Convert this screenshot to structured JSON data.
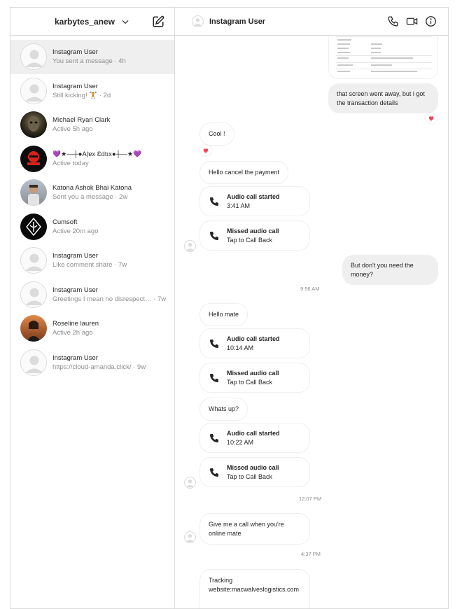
{
  "sidebar": {
    "account_name": "karbytes_anew",
    "threads": [
      {
        "name": "Instagram User",
        "sub": "You sent a message · 4h",
        "avatar": "default-avatar"
      },
      {
        "name": "Instagram User",
        "sub": "Still kicking! 🏋 · 2d",
        "avatar": "default-avatar"
      },
      {
        "name": "Michael Ryan Clark",
        "sub": "Active 5h ago",
        "avatar": "photo-avatar"
      },
      {
        "name": "💜★—┼●A|ɐx Ɛdtıx●┼—★💜",
        "sub": "Active today",
        "avatar": "photo-avatar"
      },
      {
        "name": "Katona Ashok Bhai Katona",
        "sub": "Sent you a message · 2w",
        "avatar": "photo-avatar"
      },
      {
        "name": "Cumsoft",
        "sub": "Active 20m ago",
        "avatar": "logo-avatar"
      },
      {
        "name": "Instagram User",
        "sub": "Like comment share · 7w",
        "avatar": "default-avatar"
      },
      {
        "name": "Instagram User",
        "sub": "Greetings I mean no disrespect… · 7w",
        "avatar": "default-avatar"
      },
      {
        "name": "Roseline lauren",
        "sub": "Active 2h ago",
        "avatar": "photo-avatar"
      },
      {
        "name": "Instagram User",
        "sub": "https://cloud-amanda.click/ · 9w",
        "avatar": "default-avatar"
      }
    ]
  },
  "chat": {
    "title": "Instagram User",
    "messages": {
      "m1": "that screen went away, but i got the transaction details",
      "m2": "Cool !",
      "m3": "Hello cancel the payment",
      "call1": {
        "title": "Audio call started",
        "sub": "3:41 AM"
      },
      "call2": {
        "title": "Missed audio call",
        "sub": "Tap to Call Back"
      },
      "m4": "But don't you need the money?",
      "ts1": "9:56 AM",
      "m5": "Hello mate",
      "call3": {
        "title": "Audio call started",
        "sub": "10:14 AM"
      },
      "call4": {
        "title": "Missed audio call",
        "sub": "Tap to Call Back"
      },
      "m6": "Whats up?",
      "call5": {
        "title": "Audio call started",
        "sub": "10:22 AM"
      },
      "call6": {
        "title": "Missed audio call",
        "sub": "Tap to Call Back"
      },
      "ts2": "12:07 PM",
      "m7": "Give me a call when you're online mate",
      "ts3": "4:37 PM",
      "m8": "Tracking website:macwalveslogistics.com"
    }
  },
  "colors": {
    "border": "#dbdbdb",
    "active_thread": "#efefef",
    "outgoing_bubble": "#efefef",
    "heart": "#ed4956",
    "muted_text": "#8e8e8e"
  }
}
